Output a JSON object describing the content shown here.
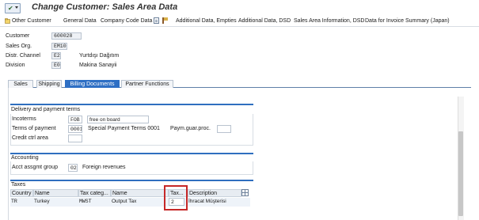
{
  "window": {
    "title": "Change Customer: Sales Area Data"
  },
  "toolbar": {
    "other_customer": "Other Customer",
    "general_data": "General Data",
    "company_code_data": "Company Code Data",
    "additional_data_empties": "Additional Data, Empties",
    "additional_data_dsd": "Additional Data, DSD",
    "sales_area_info_dsd": "Sales Area Information, DSD",
    "invoice_summary": "Data for Invoice Summary (Japan)"
  },
  "header": {
    "customer_label": "Customer",
    "customer_value": "600028",
    "sales_org_label": "Sales Org.",
    "sales_org_value": "EM10",
    "distr_channel_label": "Distr. Channel",
    "distr_channel_value": "E2",
    "distr_channel_desc": "Yurtdışı Dağıtım",
    "division_label": "Division",
    "division_value": "E0",
    "division_desc": "Makina Sanayii"
  },
  "tabs": [
    {
      "label": "Sales",
      "active": false
    },
    {
      "label": "Shipping",
      "active": false
    },
    {
      "label": "Billing Documents",
      "active": true
    },
    {
      "label": "Partner Functions",
      "active": false
    }
  ],
  "delivery": {
    "title": "Delivery and payment terms",
    "incoterms_label": "Incoterms",
    "incoterms_code": "FOB",
    "incoterms_text": "free on board",
    "payment_terms_label": "Terms of payment",
    "payment_terms_code": "0001",
    "payment_terms_desc": "Special Payment Terms 0001",
    "paym_guar_label": "Paym.guar.proc.",
    "paym_guar_value": "",
    "credit_area_label": "Credit ctrl area",
    "credit_area_value": ""
  },
  "accounting": {
    "title": "Accounting",
    "acct_group_label": "Acct assgmt group",
    "acct_group_value": "02",
    "acct_group_desc": "Foreign revenues"
  },
  "taxes": {
    "title": "Taxes",
    "columns": [
      "Country",
      "Name",
      "Tax categ...",
      "Name",
      "Tax...",
      "Description"
    ],
    "rows": [
      {
        "country": "TR",
        "country_name": "Turkey",
        "tax_category": "MWST",
        "category_name": "Output Tax",
        "tax_class": "2",
        "description": "İhracat Müşterisi"
      }
    ]
  },
  "colors": {
    "accent": "#2f6fbf",
    "active_tab": "#2e6fc4",
    "highlight": "#c62828"
  }
}
